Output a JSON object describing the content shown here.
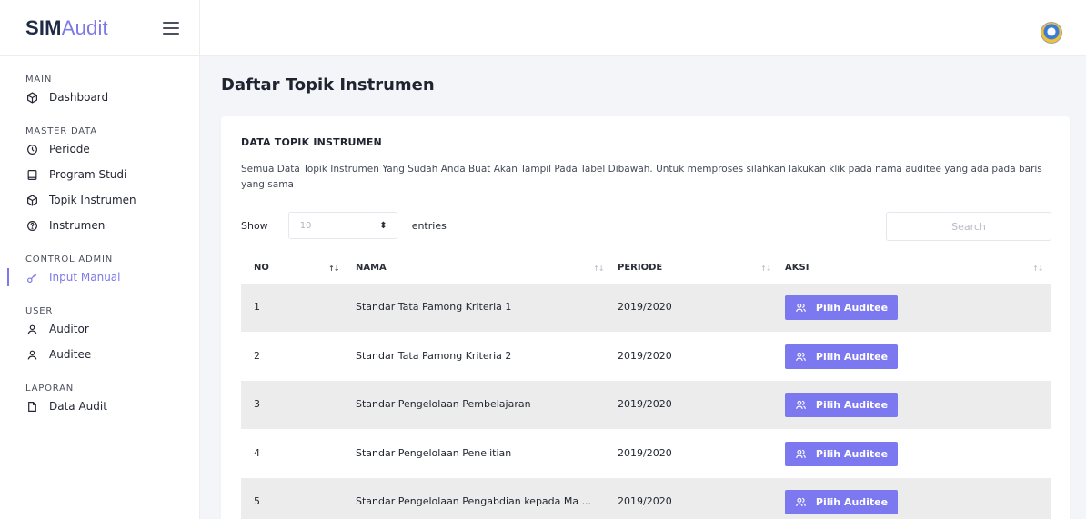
{
  "brand": {
    "strong": "SIM",
    "light": "Audit"
  },
  "sidebar": {
    "sections": [
      {
        "title": "MAIN",
        "items": [
          {
            "label": "Dashboard",
            "icon": "cube-icon"
          }
        ]
      },
      {
        "title": "MASTER DATA",
        "items": [
          {
            "label": "Periode",
            "icon": "clock-icon"
          },
          {
            "label": "Program Studi",
            "icon": "square-icon"
          },
          {
            "label": "Topik Instrumen",
            "icon": "cube-icon"
          },
          {
            "label": "Instrumen",
            "icon": "help-circle-icon"
          }
        ]
      },
      {
        "title": "CONTROL ADMIN",
        "items": [
          {
            "label": "Input Manual",
            "icon": "key-icon",
            "active": true
          }
        ]
      },
      {
        "title": "USER",
        "items": [
          {
            "label": "Auditor",
            "icon": "user-icon"
          },
          {
            "label": "Auditee",
            "icon": "user-icon"
          }
        ]
      },
      {
        "title": "LAPORAN",
        "items": [
          {
            "label": "Data Audit",
            "icon": "file-icon"
          }
        ]
      }
    ]
  },
  "page": {
    "title": "Daftar Topik Instrumen"
  },
  "card": {
    "title": "DATA TOPIK INSTRUMEN",
    "description": "Semua Data Topik Instrumen Yang Sudah Anda Buat Akan Tampil Pada Tabel Dibawah. Untuk memproses silahkan lakukan klik pada nama auditee yang ada pada baris yang sama",
    "show_label": "Show",
    "show_value": "10",
    "entries_label": "entries",
    "search_placeholder": "Search"
  },
  "table": {
    "headers": {
      "no": "NO",
      "nama": "NAMA",
      "periode": "PERIODE",
      "aksi": "AKSI"
    },
    "action_label": "Pilih Auditee",
    "rows": [
      {
        "no": "1",
        "nama": "Standar Tata Pamong Kriteria 1",
        "periode": "2019/2020"
      },
      {
        "no": "2",
        "nama": "Standar Tata Pamong Kriteria 2",
        "periode": "2019/2020"
      },
      {
        "no": "3",
        "nama": "Standar Pengelolaan Pembelajaran",
        "periode": "2019/2020"
      },
      {
        "no": "4",
        "nama": "Standar Pengelolaan Penelitian",
        "periode": "2019/2020"
      },
      {
        "no": "5",
        "nama": "Standar Pengelolaan Pengabdian kepada Ma ...",
        "periode": "2019/2020"
      }
    ]
  },
  "colors": {
    "accent": "#7c78f0",
    "brand_light": "#7c78e8"
  }
}
